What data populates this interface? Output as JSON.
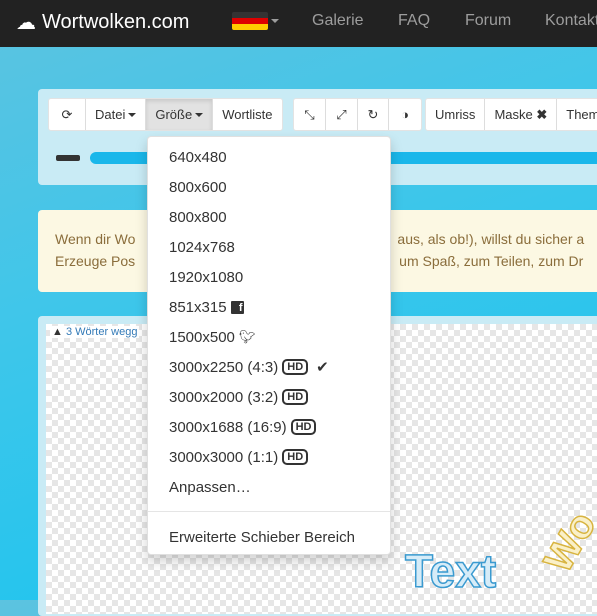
{
  "nav": {
    "brand": "Wortwolken.com",
    "links": [
      "Galerie",
      "FAQ",
      "Forum",
      "Kontakt"
    ]
  },
  "toolbar": {
    "datei": "Datei",
    "groesse": "Größe",
    "wortliste": "Wortliste",
    "umriss": "Umriss",
    "maske": "Maske",
    "themen": "Them"
  },
  "alert": {
    "line1_left": "Wenn dir Wo",
    "line1_right": "aus, als ob!), willst du sicher a",
    "line2_left": "Erzeuge Pos",
    "line2_right": "um Spaß, zum Teilen, zum Dr"
  },
  "canvas": {
    "warning": "3 Wörter wegg",
    "words": [
      "Text",
      "Wo"
    ]
  },
  "menu": {
    "items": [
      {
        "label": "640x480"
      },
      {
        "label": "800x600"
      },
      {
        "label": "800x800"
      },
      {
        "label": "1024x768"
      },
      {
        "label": "1920x1080"
      },
      {
        "label": "851x315",
        "icon": "facebook-icon"
      },
      {
        "label": "1500x500",
        "icon": "twitter-icon"
      },
      {
        "label": "3000x2250 (4:3)",
        "badge": "HD",
        "checked": true
      },
      {
        "label": "3000x2000 (3:2)",
        "badge": "HD"
      },
      {
        "label": "3000x1688 (16:9)",
        "badge": "HD"
      },
      {
        "label": "3000x3000 (1:1)",
        "badge": "HD"
      },
      {
        "label": "Anpassen…"
      }
    ],
    "extra": "Erweiterte Schieber Bereich"
  }
}
